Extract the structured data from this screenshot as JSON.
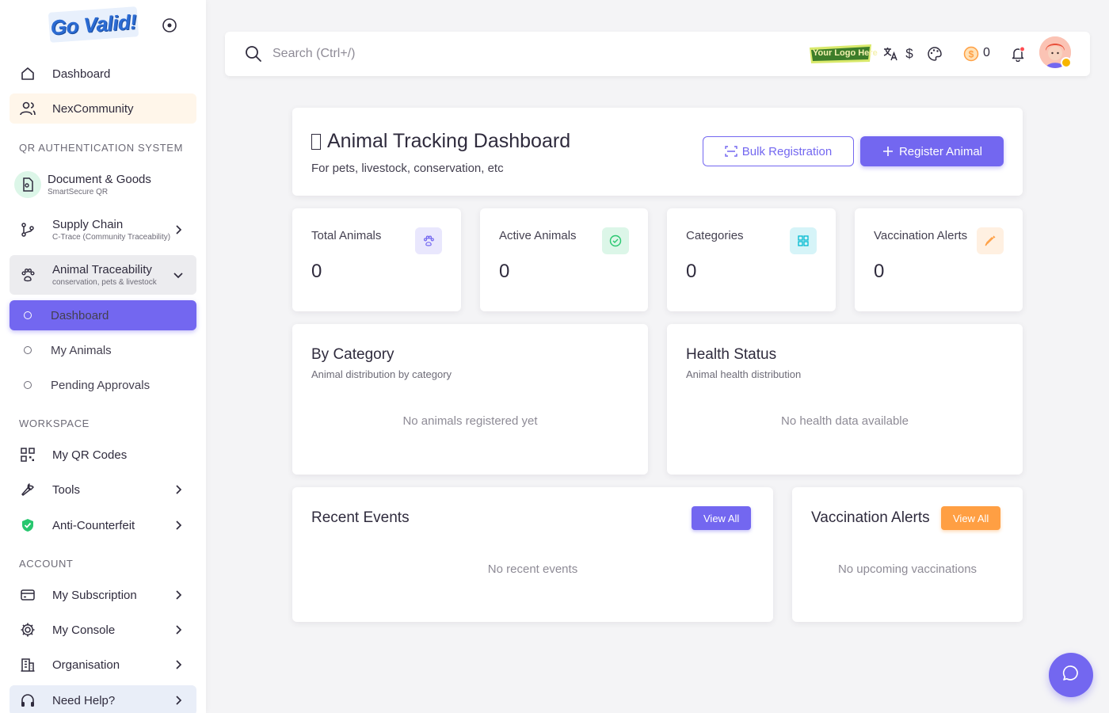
{
  "brand": {
    "name": "Go Valid!"
  },
  "sidebar": {
    "top_items": [
      {
        "label": "Dashboard",
        "icon": "home-icon"
      },
      {
        "label": "NexCommunity",
        "icon": "users-icon"
      }
    ],
    "sections": {
      "qr": "QR AUTHENTICATION SYSTEM",
      "workspace": "WORKSPACE",
      "account": "ACCOUNT"
    },
    "qr_items": [
      {
        "label": "Document & Goods",
        "sub": "SmartSecure QR"
      },
      {
        "label": "Supply Chain",
        "sub": "C-Trace (Community Traceability)"
      },
      {
        "label": "Animal Traceability",
        "sub": "conservation, pets & livestock"
      }
    ],
    "animal_sub": [
      {
        "label": "Dashboard"
      },
      {
        "label": "My Animals"
      },
      {
        "label": "Pending Approvals"
      }
    ],
    "workspace_items": [
      {
        "label": "My QR Codes"
      },
      {
        "label": "Tools"
      },
      {
        "label": "Anti-Counterfeit"
      }
    ],
    "account_items": [
      {
        "label": "My Subscription"
      },
      {
        "label": "My Console"
      },
      {
        "label": "Organisation"
      },
      {
        "label": "Need Help?"
      }
    ]
  },
  "topbar": {
    "search_placeholder": "Search (Ctrl+/)",
    "logo_text": "Your Logo Here",
    "currency_symbol": "$",
    "coins": "0"
  },
  "hero": {
    "title": "Animal Tracking Dashboard",
    "subtitle": "For pets, livestock, conservation, etc",
    "bulk_label": "Bulk Registration",
    "register_label": "Register Animal"
  },
  "stats": [
    {
      "label": "Total Animals",
      "value": "0",
      "icon": "paw-icon",
      "color": "#7367f0",
      "bg": "#e9e7fd"
    },
    {
      "label": "Active Animals",
      "value": "0",
      "icon": "check-circle-icon",
      "color": "#28c76f",
      "bg": "#dcf6e8"
    },
    {
      "label": "Categories",
      "value": "0",
      "icon": "grid-icon",
      "color": "#00bad1",
      "bg": "#d6f4f8"
    },
    {
      "label": "Vaccination Alerts",
      "value": "0",
      "icon": "syringe-icon",
      "color": "#ff9f43",
      "bg": "#fff0e1"
    }
  ],
  "panels": {
    "category": {
      "title": "By Category",
      "subtitle": "Animal distribution by category",
      "empty": "No animals registered yet"
    },
    "health": {
      "title": "Health Status",
      "subtitle": "Animal health distribution",
      "empty": "No health data available"
    },
    "events": {
      "title": "Recent Events",
      "button": "View All",
      "empty": "No recent events"
    },
    "vaccinations": {
      "title": "Vaccination Alerts",
      "button": "View All",
      "empty": "No upcoming vaccinations"
    }
  },
  "colors": {
    "primary": "#7367f0",
    "warning": "#ff9f43",
    "success": "#28c76f",
    "info": "#00bad1"
  }
}
